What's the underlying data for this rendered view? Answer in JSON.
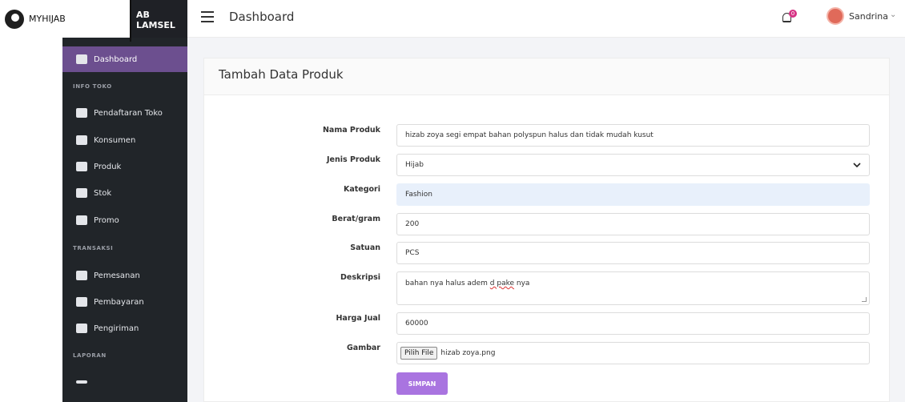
{
  "brand": {
    "logo_text": "MYHIJAB",
    "header_brand": "AB LAMSEL"
  },
  "header": {
    "title": "Dashboard",
    "notif_count": "0",
    "user_name": "Sandrina"
  },
  "sidebar": {
    "dashboard": "Dashboard",
    "section_info": "INFO TOKO",
    "pendaftaran": "Pendaftaran Toko",
    "konsumen": "Konsumen",
    "produk": "Produk",
    "stok": "Stok",
    "promo": "Promo",
    "section_transaksi": "TRANSAKSI",
    "pemesanan": "Pemesanan",
    "pembayaran": "Pembayaran",
    "pengiriman": "Pengiriman",
    "section_laporan": "LAPORAN"
  },
  "card": {
    "title": "Tambah Data Produk"
  },
  "form": {
    "nama_label": "Nama Produk",
    "nama_value": "hizab zoya segi empat bahan polyspun halus dan tidak mudah kusut",
    "jenis_label": "Jenis Produk",
    "jenis_value": "Hijab",
    "kategori_label": "Kategori",
    "kategori_value": "Fashion",
    "berat_label": "Berat/gram",
    "berat_value": "200",
    "satuan_label": "Satuan",
    "satuan_value": "PCS",
    "deskripsi_label": "Deskripsi",
    "deskripsi_a": "bahan nya halus adem ",
    "deskripsi_b": "d pake",
    "deskripsi_c": " nya",
    "harga_label": "Harga Jual",
    "harga_value": "60000",
    "gambar_label": "Gambar",
    "file_button": "Pilih File",
    "file_name": "hizab zoya.png",
    "submit": "SIMPAN"
  }
}
